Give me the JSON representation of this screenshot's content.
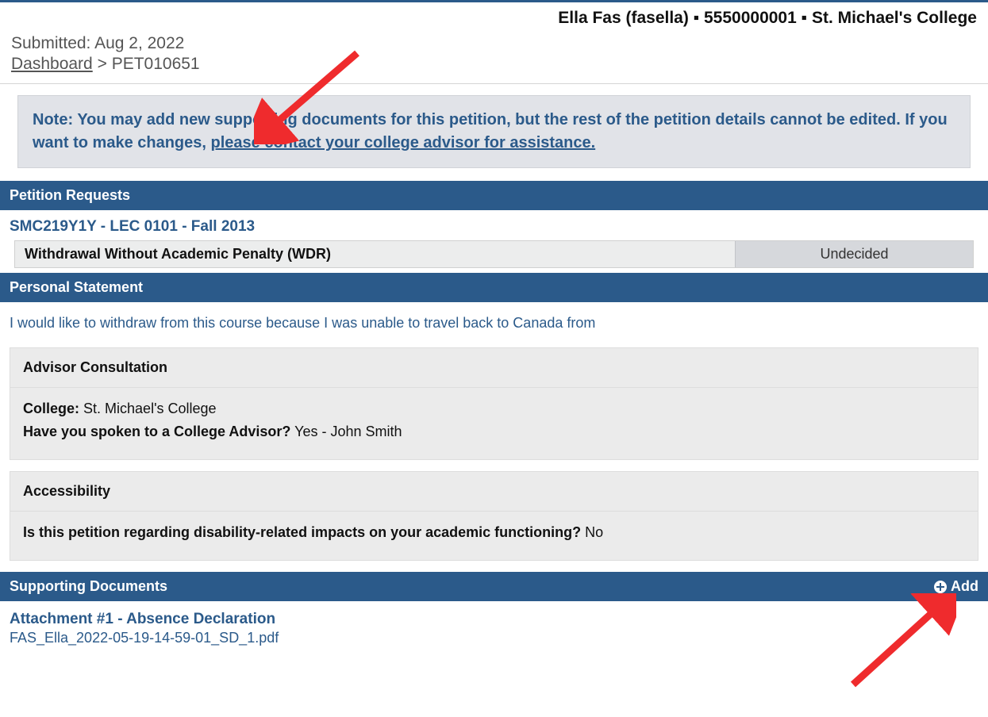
{
  "header": {
    "user_display": "Ella Fas (fasella)",
    "sep1": "▪",
    "student_id": "5550000001",
    "sep2": "▪",
    "college": "St. Michael's College"
  },
  "meta": {
    "submitted_label": "Submitted:",
    "submitted_date": "Aug 2, 2022"
  },
  "breadcrumb": {
    "dashboard_label": "Dashboard",
    "sep": ">",
    "current": "PET010651"
  },
  "note": {
    "prefix": "Note:",
    "line1": "You may add new supporting documents for this petition, but the rest of the petition details cannot be edited.",
    "line2_a": "If you want to make changes,",
    "line2_link": "please contact your college advisor for assistance."
  },
  "sections": {
    "petition_requests": "Petition Requests",
    "personal_statement": "Personal Statement",
    "supporting_documents": "Supporting Documents"
  },
  "petition": {
    "course": "SMC219Y1Y - LEC 0101 - Fall 2013",
    "request_name": "Withdrawal Without Academic Penalty (WDR)",
    "request_status": "Undecided"
  },
  "personal_statement": {
    "text": "I would like to withdraw from this course because I was unable to travel back to Canada from"
  },
  "advisor": {
    "title": "Advisor Consultation",
    "college_label": "College:",
    "college_value": "St. Michael's College",
    "spoken_label": "Have you spoken to a College Advisor?",
    "spoken_value": "Yes - John Smith"
  },
  "accessibility": {
    "title": "Accessibility",
    "q_label": "Is this petition regarding disability-related impacts on your academic functioning?",
    "q_value": "No"
  },
  "documents": {
    "add_label": "Add",
    "items": [
      {
        "title": "Attachment #1 - Absence Declaration",
        "filename": "FAS_Ella_2022-05-19-14-59-01_SD_1.pdf"
      }
    ]
  }
}
